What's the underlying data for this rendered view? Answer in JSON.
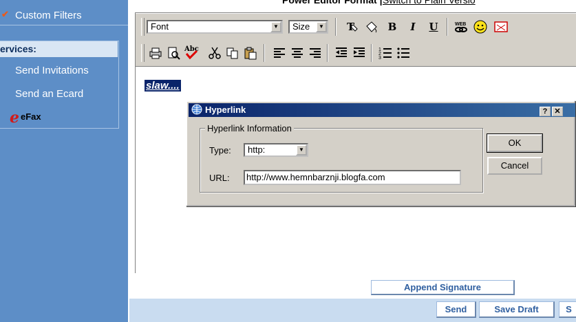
{
  "sidebar": {
    "custom_filters": "Custom Filters",
    "services_heading": "ervices:",
    "send_invitations": "Send Invitations",
    "send_ecard": "Send an Ecard",
    "efax_logo": "eFax"
  },
  "header": {
    "editor_mode": "Power Editor Format",
    "divider": "|",
    "switch_link": "Switch to Plain Versio"
  },
  "toolbar": {
    "font_value": "Font",
    "size_value": "Size",
    "bold": "B",
    "italic": "I",
    "underline": "U",
    "spell": "Abc"
  },
  "editor": {
    "selected_text": "slaw...."
  },
  "dialog": {
    "title": "Hyperlink",
    "help_button": "?",
    "close_button": "✕",
    "group_label": "Hyperlink Information",
    "type_label": "Type:",
    "type_value": "http:",
    "url_label": "URL:",
    "url_value": "http://www.hemnbarznji.blogfa.com",
    "ok_label": "OK",
    "cancel_label": "Cancel"
  },
  "footer": {
    "append_signature": "Append Signature",
    "send": "Send",
    "save_draft": "Save Draft",
    "more": "S"
  },
  "colors": {
    "sidebar_bg": "#5d8ec7",
    "toolbar_bg": "#d4d0c8",
    "title_bar": "#0a246a",
    "button_text": "#2f5fa0"
  }
}
